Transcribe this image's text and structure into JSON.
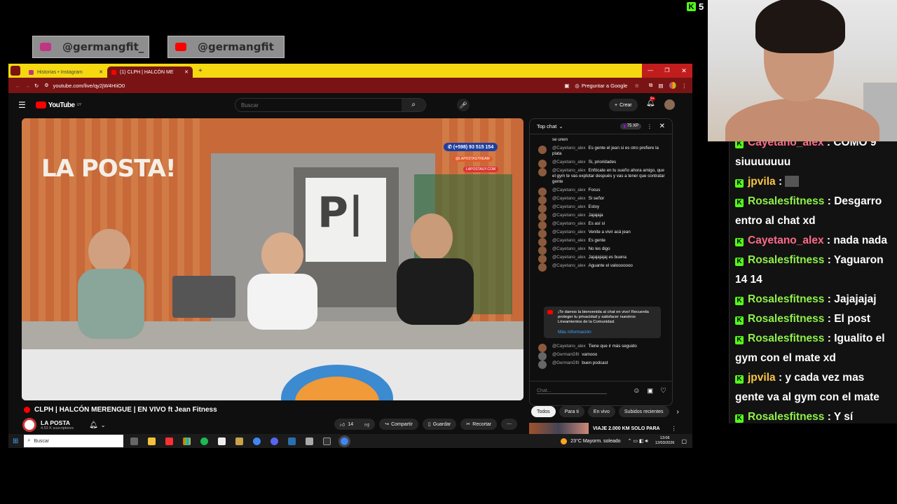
{
  "socials": [
    {
      "handle": "@germangfit_",
      "icon": "instagram-icon",
      "color": "#c13584"
    },
    {
      "handle": "@germangfit",
      "icon": "youtube-icon",
      "color": "#ff0000"
    }
  ],
  "kick": {
    "viewers": "5",
    "messages": [
      {
        "user": "Cayetano_alex",
        "color": "#ff6b8a",
        "text": "COMO 9 siuuuuuuu"
      },
      {
        "user": "jpvila",
        "color": "#f7c645",
        "text": ""
      },
      {
        "user": "Rosalesfitness",
        "color": "#8ff04a",
        "text": "Desgarro entro al chat xd"
      },
      {
        "user": "Cayetano_alex",
        "color": "#ff6b8a",
        "text": "nada nada"
      },
      {
        "user": "Rosalesfitness",
        "color": "#8ff04a",
        "text": "Yaguaron 14 14"
      },
      {
        "user": "Rosalesfitness",
        "color": "#8ff04a",
        "text": "Jajajajaj"
      },
      {
        "user": "Rosalesfitness",
        "color": "#8ff04a",
        "text": "El post"
      },
      {
        "user": "Rosalesfitness",
        "color": "#8ff04a",
        "text": "Igualito el gym con el mate xd"
      },
      {
        "user": "jpvila",
        "color": "#f7c645",
        "text": "y cada vez mas gente va al gym con el mate"
      },
      {
        "user": "Rosalesfitness",
        "color": "#8ff04a",
        "text": "Y sí"
      }
    ]
  },
  "browser": {
    "tabs": [
      {
        "label": "Historias • Instagram"
      },
      {
        "label": "(1) CLPH | HALCÓN ME"
      }
    ],
    "url": "youtube.com/live/qy2jW4HIiO0",
    "ask_google": "Preguntar a Google"
  },
  "youtube": {
    "logo": "YouTube",
    "region": "UY",
    "search_placeholder": "Buscar",
    "create": "Crear",
    "notif_count": "9+",
    "video": {
      "wall_text": "LA POSTA!",
      "logo_text": "P|",
      "phone": "(+598) 93 515 154",
      "ig": "@LAPOSTASTREAM",
      "web": "LAPOSTAUY.COM"
    },
    "title": "CLPH | HALCÓN MERENGUE | EN VIVO ft Jean Fitness",
    "channel": "LA POSTA",
    "subs": "4.53 K suscriptores",
    "likes": "14",
    "share": "Compartir",
    "save": "Guardar",
    "clip": "Recortar"
  },
  "chat": {
    "header": "Top chat",
    "xp": "75 XP",
    "messages": [
      {
        "author": "",
        "text": "se unen"
      },
      {
        "author": "@Cayetano_alex",
        "text": "Es gente el jean si es otro prefiere la plata"
      },
      {
        "author": "@Cayetano_alex",
        "text": "Si, prioridades"
      },
      {
        "author": "@Cayetano_alex",
        "text": "Enfócate en tu sueño ahora amigo, que el gym te vas explotar después y vas a tener que contratar gente"
      },
      {
        "author": "@Cayetano_alex",
        "text": "Focus"
      },
      {
        "author": "@Cayetano_alex",
        "text": "Si señor"
      },
      {
        "author": "@Cayetano_alex",
        "text": "Estoy"
      },
      {
        "author": "@Cayetano_alex",
        "text": "Jajajaja"
      },
      {
        "author": "@Cayetano_alex",
        "text": "Es así sí"
      },
      {
        "author": "@Cayetano_alex",
        "text": "Venite a vivir acá jean"
      },
      {
        "author": "@Cayetano_alex",
        "text": "Es gente"
      },
      {
        "author": "@Cayetano_alex",
        "text": "No les digo"
      },
      {
        "author": "@Cayetano_alex",
        "text": "Jajajajajaj es buena"
      },
      {
        "author": "@Cayetano_alex",
        "text": "Aguante el valooooooo"
      }
    ],
    "notice": "¡Te damos la bienvenida al chat en vivo! Recuerda proteger tu privacidad y satisfacer nuestros Lineamientos de la Comunidad.",
    "notice_link": "Más información",
    "after": [
      {
        "author": "@Cayetano_alex",
        "text": "Tiene que ir más seguido"
      },
      {
        "author": "@GermanGfit",
        "text": "vamooo"
      },
      {
        "author": "@GermanGfit",
        "text": "buen podcast"
      }
    ],
    "input_placeholder": "Chat...",
    "filters": [
      "Todos",
      "Para ti",
      "En vivo",
      "Subidos recientes"
    ],
    "rec_title": "VIAJE 2.000 KM SOLO PARA"
  },
  "taskbar": {
    "search": "Buscar",
    "weather": "23°C  Mayorm. soleado",
    "time": "13:06",
    "date": "12/03/2026"
  }
}
